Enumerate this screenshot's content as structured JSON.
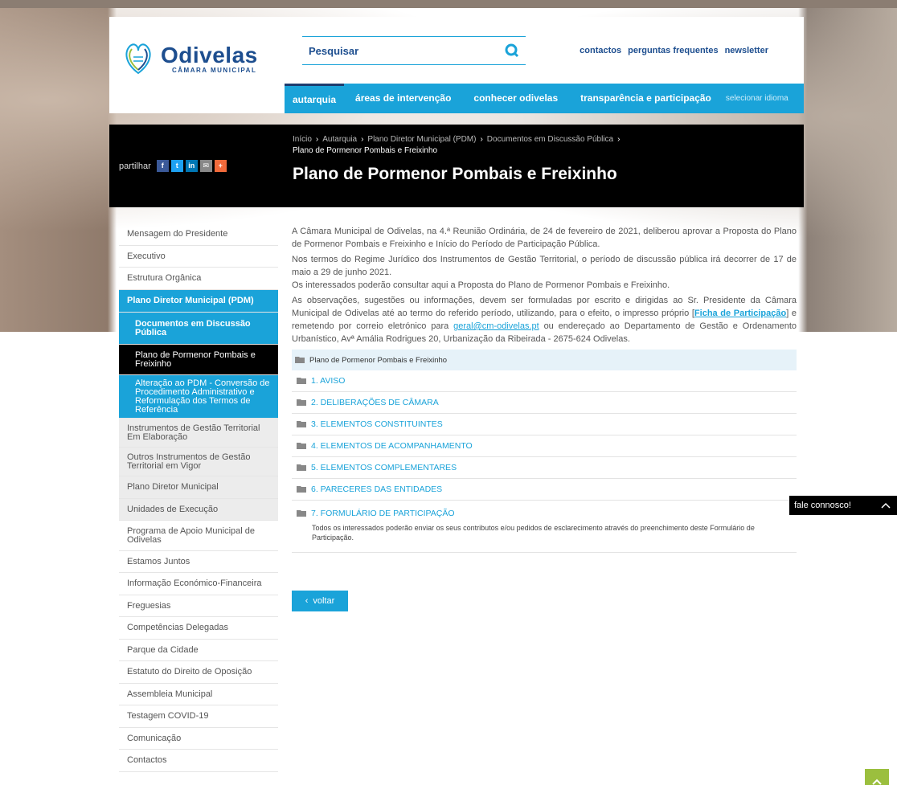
{
  "header": {
    "logo_title": "Odivelas",
    "logo_sub": "CÂMARA MUNICIPAL",
    "search_label": "Pesquisar",
    "top_links": [
      "contactos",
      "perguntas frequentes",
      "newsletter"
    ],
    "nav": [
      "autarquia",
      "áreas de intervenção",
      "conhecer odivelas",
      "transparência e participação"
    ],
    "lang": "selecionar idioma"
  },
  "titlebar": {
    "share_label": "partilhar",
    "breadcrumb": [
      "Início",
      "Autarquia",
      "Plano Diretor Municipal (PDM)",
      "Documentos em Discussão Pública"
    ],
    "breadcrumb_current": "Plano de Pormenor Pombais e Freixinho",
    "title": "Plano de Pormenor Pombais e Freixinho"
  },
  "sidebar": {
    "items": [
      "Mensagem do Presidente",
      "Executivo",
      "Estrutura Orgânica",
      "Plano Diretor Municipal (PDM)",
      "Documentos em Discussão Pública",
      "Plano de Pormenor Pombais e Freixinho",
      "Alteração ao PDM - Conversão de Procedimento Administrativo e Reformulação dos Termos de Referência",
      "Instrumentos de Gestão Territorial Em Elaboração",
      "Outros Instrumentos de Gestão Territorial em Vigor",
      "Plano Diretor Municipal",
      "Unidades de Execução",
      "Programa de Apoio Municipal de Odivelas",
      "Estamos Juntos",
      "Informação Económico-Financeira",
      "Freguesias",
      "Competências Delegadas",
      "Parque da Cidade",
      "Estatuto do Direito de Oposição",
      "Assembleia Municipal",
      "Testagem COVID-19",
      "Comunicação",
      "Contactos"
    ]
  },
  "content": {
    "p1": "A Câmara Municipal de Odivelas, na 4.ª Reunião Ordinária, de 24 de fevereiro de 2021, deliberou aprovar a Proposta do Plano de Pormenor Pombais e Freixinho e Início do Período de Participação Pública.",
    "p2": "Nos termos do Regime Jurídico dos Instrumentos de Gestão Territorial, o período de discussão pública irá decorrer de 17 de maio a 29 de junho 2021.",
    "p3": "Os interessados poderão consultar aqui a Proposta do Plano de Pormenor Pombais e Freixinho.",
    "p4_a": "As observações, sugestões ou informações, devem ser formuladas por escrito e dirigidas ao Sr. Presidente da Câmara Municipal de Odivelas até ao termo do referido período, utilizando, para o efeito, o impresso próprio [",
    "p4_link": "Ficha de Participação",
    "p4_b": "] e remetendo por correio eletrónico para ",
    "p4_mail": "geral@cm-odivelas.pt",
    "p4_c": " ou endereçado ao Departamento de Gestão e Ordenamento Urbanístico, Avª Amália Rodrigues 20, Urbanização da Ribeirada - 2675-624 Odivelas.",
    "folder": "Plano de Pormenor Pombais e Freixinho",
    "docs": [
      "1. AVISO",
      "2. DELIBERAÇÕES DE CÂMARA",
      "3. ELEMENTOS CONSTITUINTES",
      "4. ELEMENTOS DE ACOMPANHAMENTO",
      "5. ELEMENTOS COMPLEMENTARES",
      "6. PARECERES DAS ENTIDADES",
      "7. FORMULÁRIO DE PARTICIPAÇÃO"
    ],
    "doc7_desc": "Todos os interessados poderão enviar os seus contributos e/ou pedidos de esclarecimento através do preenchimento deste Formulário de Participação.",
    "back": "voltar"
  },
  "chat": {
    "label": "fale connosco!"
  },
  "colors": {
    "primary": "#1aa3d9",
    "brand_dark": "#1d4e8f",
    "green": "#9bbf3e",
    "black": "#000000"
  }
}
